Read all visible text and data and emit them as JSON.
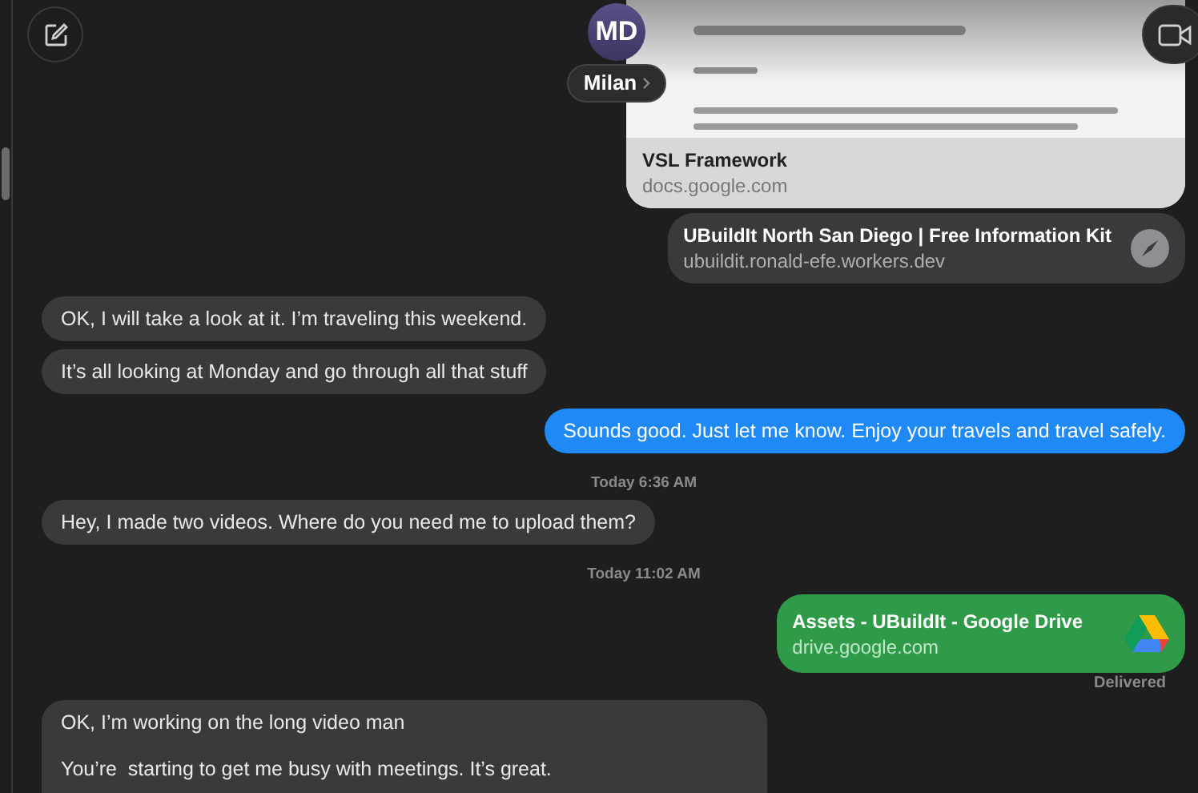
{
  "contact": {
    "initials": "MD",
    "name": "Milan"
  },
  "messages": [
    {
      "kind": "doc_link",
      "title": "VSL Framework",
      "domain": "docs.google.com"
    },
    {
      "kind": "web_link",
      "title": "UBuildIt North San Diego | Free Information Kit",
      "domain": "ubuildit.ronald-efe.workers.dev",
      "color": "#3a3a3c"
    },
    {
      "kind": "incoming",
      "text": "OK, I will take a look at it. I’m traveling this weekend."
    },
    {
      "kind": "incoming",
      "text": "It’s all looking at Monday and go through all that stuff"
    },
    {
      "kind": "outgoing",
      "text": "Sounds good. Just let me know. Enjoy your travels and travel safely."
    },
    {
      "kind": "timestamp",
      "text": "Today 6:36 AM"
    },
    {
      "kind": "incoming",
      "text": "Hey, I made two videos. Where do you need me to upload them?"
    },
    {
      "kind": "timestamp",
      "text": "Today 11:02 AM"
    },
    {
      "kind": "file_link",
      "title": "Assets - UBuildIt - Google Drive",
      "domain": "drive.google.com",
      "color": "#2f9a47",
      "status": "Delivered"
    },
    {
      "kind": "incoming_multi",
      "lines": [
        "OK, I’m working on the long video man",
        "You’re  starting to get me busy with meetings. It’s great."
      ]
    }
  ]
}
